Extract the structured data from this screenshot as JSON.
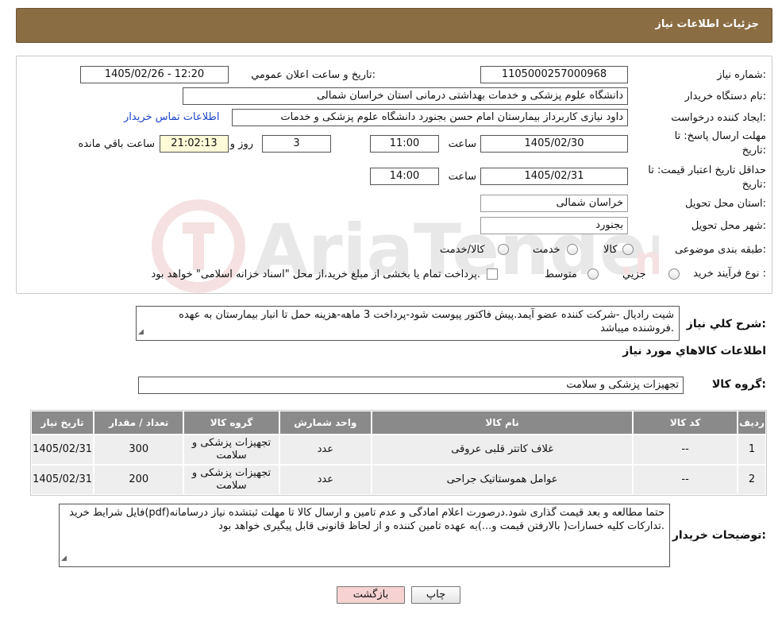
{
  "header": {
    "title": "جزئیات اطلاعات نیاز"
  },
  "form": {
    "need_number_label": "شماره نیاز:",
    "need_number": "1105000257000968",
    "announce_label": "تاریخ و ساعت اعلان عمومي:",
    "announce_value": "1405/02/26 - 12:20",
    "buyer_org_label": "نام دستگاه خريدار:",
    "buyer_org": "دانشگاه علوم پزشکی و خدمات بهداشتی درمانی استان خراسان شمالی",
    "requester_label": "ايجاد کننده درخواست:",
    "requester": "داود نیازی کاربرداز بیمارستان امام حسن بجنورد دانشگاه علوم پزشکی و خدمات",
    "contact_link": "اطلاعات تماس خريدار",
    "deadline_label_1": "مهلت ارسال پاسخ: تا",
    "deadline_label_2": "تاريخ:",
    "deadline_date": "1405/02/30",
    "time_label": "ساعت",
    "deadline_time": "11:00",
    "days_count": "3",
    "days_label": "روز و",
    "remaining_time": "21:02:13",
    "remaining_label": "ساعت باقي مانده",
    "validity_label_1": "حداقل تاريخ اعتبار قيمت: تا",
    "validity_label_2": "تاريخ:",
    "validity_date": "1405/02/31",
    "validity_time": "14:00",
    "province_label": "استان محل تحويل:",
    "province": "خراسان شمالی",
    "city_label": "شهر محل تحويل:",
    "city": "بجنورد",
    "category_label": "طبقه بندی موضوعی:",
    "category_options": [
      "کالا",
      "خدمت",
      "کالا/خدمت"
    ],
    "process_label": "نوع فرآيند خريد :",
    "process_options": [
      "جزيي",
      "متوسط"
    ],
    "process_note": "پرداخت تمام يا بخشی از مبلغ خريد،از محل \"اسناد خزانه اسلامی\" خواهد بود."
  },
  "description": {
    "label": "شرح کلي نياز:",
    "text": "شیت رادیال -شرکت کننده عضو آیمد.پیش فاکتور پیوست  شود-پرداخت 3 ماهه-هزینه حمل تا انبار بیمارستان به عهده فروشنده میباشد."
  },
  "goods_section": {
    "title": "اطلاعات کالاهاي مورد نياز",
    "group_label": "گروه کالا:",
    "group_value": "تجهیزات پزشکی و سلامت"
  },
  "table": {
    "headers": [
      "رديف",
      "کد کالا",
      "نام کالا",
      "واحد شمارش",
      "گروه کالا",
      "تعداد / مقدار",
      "تاريخ نياز"
    ],
    "rows": [
      [
        "1",
        "--",
        "غلاف کاتتر قلبی عروقی",
        "عدد",
        "تجهیزات پزشکی و سلامت",
        "300",
        "1405/02/31"
      ],
      [
        "2",
        "--",
        "عوامل هموستاتیک جراحی",
        "عدد",
        "تجهیزات پزشکی و سلامت",
        "200",
        "1405/02/31"
      ]
    ]
  },
  "buyer_notes": {
    "label": "توضيحات خريدار:",
    "text": "فایل شرایط خرید(pdf)حتما مطالعه و بعد قیمت گذاری شود.درصورت اعلام امادگی و عدم تامین و ارسال کالا تا مهلت ثبتشده نیاز درسامانه تدارکات کلیه خسارات( بالارفتن قیمت و...)به عهده تامین کننده و از لحاظ قانونی قابل پیگیری خواهد بود."
  },
  "buttons": {
    "print": "چاپ",
    "back": "بازگشت"
  },
  "colors": {
    "header_bg": "#8b6d43",
    "table_header_bg": "#8a8a8a",
    "back_button_bg": "#f6d2d2",
    "remaining_bg": "#fffbd8"
  }
}
